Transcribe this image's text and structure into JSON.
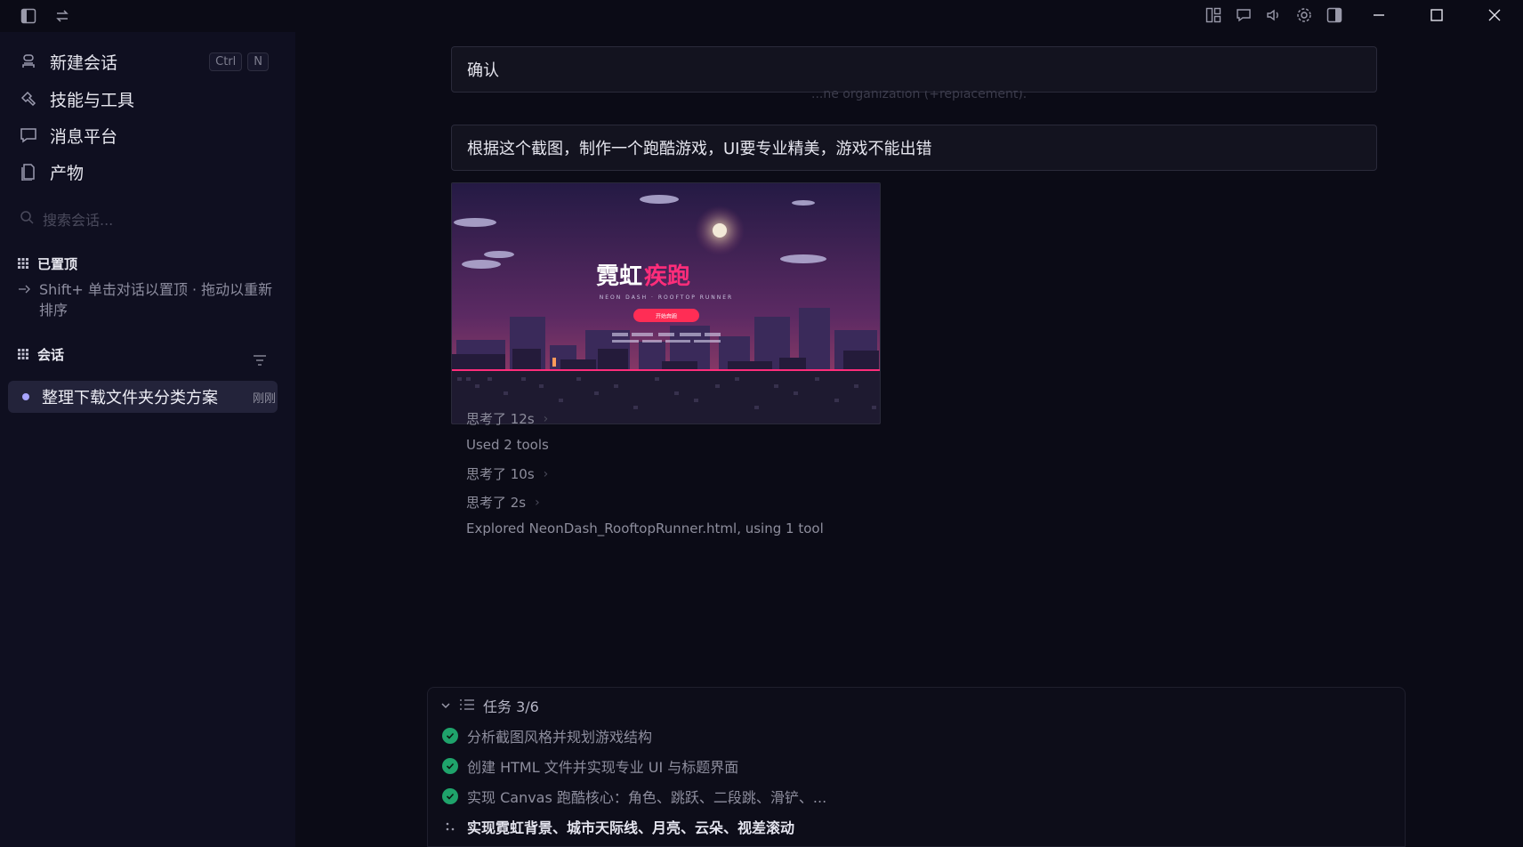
{
  "sidebar": {
    "nav": [
      {
        "label": "新建会话",
        "icon": "new-chat-icon"
      },
      {
        "label": "技能与工具",
        "icon": "skills-icon"
      },
      {
        "label": "消息平台",
        "icon": "message-icon"
      },
      {
        "label": "产物",
        "icon": "artifact-icon"
      }
    ],
    "shortcut": {
      "key1": "Ctrl",
      "key2": "N"
    },
    "search_placeholder": "搜索会话...",
    "pinned": {
      "title": "已置顶",
      "hint": "Shift+ 单击对话以置顶 · 拖动以重新排序"
    },
    "conversations": {
      "title": "会话",
      "items": [
        {
          "title": "整理下载文件夹分类方案",
          "time": "刚刚"
        }
      ]
    }
  },
  "main": {
    "message1": "确认",
    "ghost": "...he organization (+replacement).",
    "message2": "根据这个截图，制作一个跑酷游戏，UI要专业精美，游戏不能出错",
    "preview": {
      "title_white": "霓虹",
      "title_pink": "疾跑",
      "subtitle": "NEON DASH · ROOFTOP RUNNER",
      "button": "开始奔跑"
    },
    "steps": [
      {
        "text": "思考了 12s",
        "chevron": true
      },
      {
        "text": "Used 2 tools",
        "chevron": false
      },
      {
        "text": "思考了 10s",
        "chevron": true
      },
      {
        "text": "思考了 2s",
        "chevron": true
      },
      {
        "text": "Explored NeonDash_RooftopRunner.html, using 1 tool",
        "chevron": false
      }
    ],
    "tasks": {
      "title": "任务 3/6",
      "items": [
        {
          "text": "分析截图风格并规划游戏结构",
          "done": true
        },
        {
          "text": "创建 HTML 文件并实现专业 UI 与标题界面",
          "done": true
        },
        {
          "text": "实现 Canvas 跑酷核心：角色、跳跃、二段跳、滑铲、...",
          "done": true
        },
        {
          "text": "实现霓虹背景、城市天际线、月亮、云朵、视差滚动",
          "done": false
        }
      ]
    }
  },
  "colors": {
    "background": "#0b0b16",
    "sidebar": "#0f0f20",
    "accent": "#a8a4ff",
    "done": "#1fa36b",
    "neon_pink": "#ff2d7a"
  }
}
